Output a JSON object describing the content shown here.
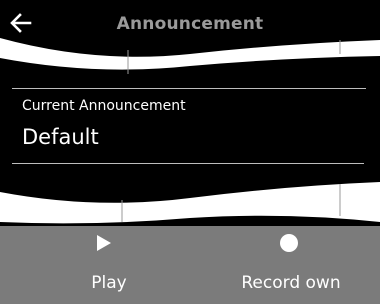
{
  "header": {
    "back_icon": "arrow-left-icon",
    "title": "Announcement"
  },
  "entry": {
    "label": "Current Announcement",
    "value": "Default"
  },
  "softkeys": {
    "left": {
      "icon": "play-icon",
      "label": "Play"
    },
    "right": {
      "icon": "record-icon",
      "label": "Record own"
    }
  },
  "colors": {
    "background": "#000000",
    "title": "#9a9a9a",
    "text": "#ffffff",
    "softkey_bar": "#7b7b7b",
    "wave": "#ffffff"
  }
}
